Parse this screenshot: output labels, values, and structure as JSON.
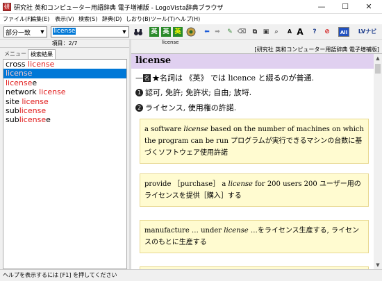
{
  "window": {
    "title": "研究社 英和コンピューター用語辞典 電子増補版 - LogoVista辞典ブラウザ",
    "minimize": "—",
    "maximize": "☐",
    "close": "✕"
  },
  "menu": [
    "ファイル(F)",
    "編集(E)",
    "表示(V)",
    "検索(S)",
    "辞典(D)",
    "しおり(B)",
    "ツール(T)",
    "ヘルプ(H)"
  ],
  "toolbar": {
    "match_mode": "部分一致",
    "search_value": "license",
    "icons": [
      "binoculars-icon",
      "dictionary-icon",
      "dictionary-icon",
      "dictionary-icon",
      "globe-icon",
      "back-arrow-icon",
      "forward-arrow-icon",
      "pencil-icon",
      "eraser-icon",
      "copy-icon",
      "paste-icon",
      "zoom-icon",
      "font-smaller-icon",
      "font-larger-icon",
      "help-icon",
      "stop-icon",
      "all-dictionaries-icon",
      "navi-icon"
    ],
    "font_small": "A",
    "font_large": "A",
    "all_label": "All",
    "navi_label": "LVナビ",
    "help_glyph": "?"
  },
  "left_panel": {
    "header": "項目：2/7",
    "tabs": [
      "メニュー",
      "検索結果"
    ],
    "items": [
      {
        "pre": "cross ",
        "match": "license",
        "post": "",
        "selected": false
      },
      {
        "pre": "",
        "match": "license",
        "post": "",
        "selected": true
      },
      {
        "pre": "",
        "match": "license",
        "post": "e",
        "selected": false
      },
      {
        "pre": "network ",
        "match": "license",
        "post": "",
        "selected": false
      },
      {
        "pre": "site ",
        "match": "license",
        "post": "",
        "selected": false
      },
      {
        "pre": "sub",
        "match": "license",
        "post": "",
        "selected": false
      },
      {
        "pre": "sub",
        "match": "license",
        "post": "e",
        "selected": false
      }
    ]
  },
  "right_panel": {
    "tab_label": "license",
    "dictionary_name": "[研究社 英和コンピューター用語辞典 電子増補版]",
    "headword": "license",
    "pos_line": {
      "prefix": "—",
      "badge": "名",
      "text": "★名詞は 《英》 では licence と綴るのが普通."
    },
    "senses": [
      {
        "num": "1",
        "text": "認可, 免許; 免許状; 自由; 放埒."
      },
      {
        "num": "2",
        "text": "ライセンス, 使用権の許諾."
      }
    ],
    "examples": [
      {
        "en_before": "a software ",
        "en_italic": "license",
        "en_after": " based on the number of machines on which the program can be run ",
        "ja": "プログラムが実行できるマシンの台数に基づくソフトウェア使用許諾"
      },
      {
        "en_before": "provide ［purchase］ a ",
        "en_italic": "license",
        "en_after": " for 200 users 200 ",
        "ja": "ユーザー用のライセンスを提供［購入］する"
      },
      {
        "en_before": "manufacture … under ",
        "en_italic": "license",
        "en_after": " …",
        "ja": "をライセンス生産する, ライセンスのもとに生産する"
      }
    ]
  },
  "status": "ヘルプを表示するには [F1] を押してください",
  "colors": {
    "headword_bg": "#e0d0f0",
    "example_bg": "#fffbd0",
    "match_red": "#e01a1a",
    "selection": "#0078d7"
  }
}
